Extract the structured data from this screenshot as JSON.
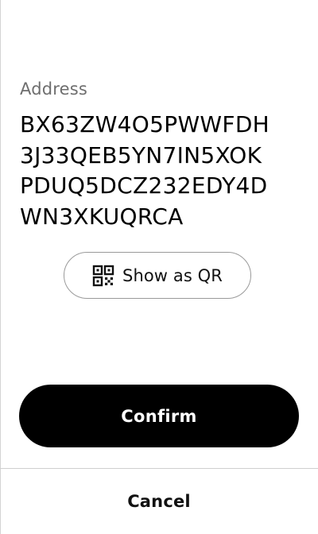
{
  "address": {
    "label": "Address",
    "lines": [
      "BX63ZW4O5PWWFDH",
      "3J33QEB5YN7IN5XOK",
      "PDUQ5DCZ232EDY4D",
      "WN3XKUQRCA"
    ]
  },
  "qr_button": {
    "label": "Show as QR",
    "icon": "qr-code-icon"
  },
  "confirm_button": {
    "label": "Confirm"
  },
  "cancel_button": {
    "label": "Cancel"
  },
  "colors": {
    "primary": "#000000",
    "on_primary": "#ffffff",
    "muted_text": "#6e6e6e",
    "border": "#9a9a9a",
    "divider": "#cfcfcf"
  }
}
